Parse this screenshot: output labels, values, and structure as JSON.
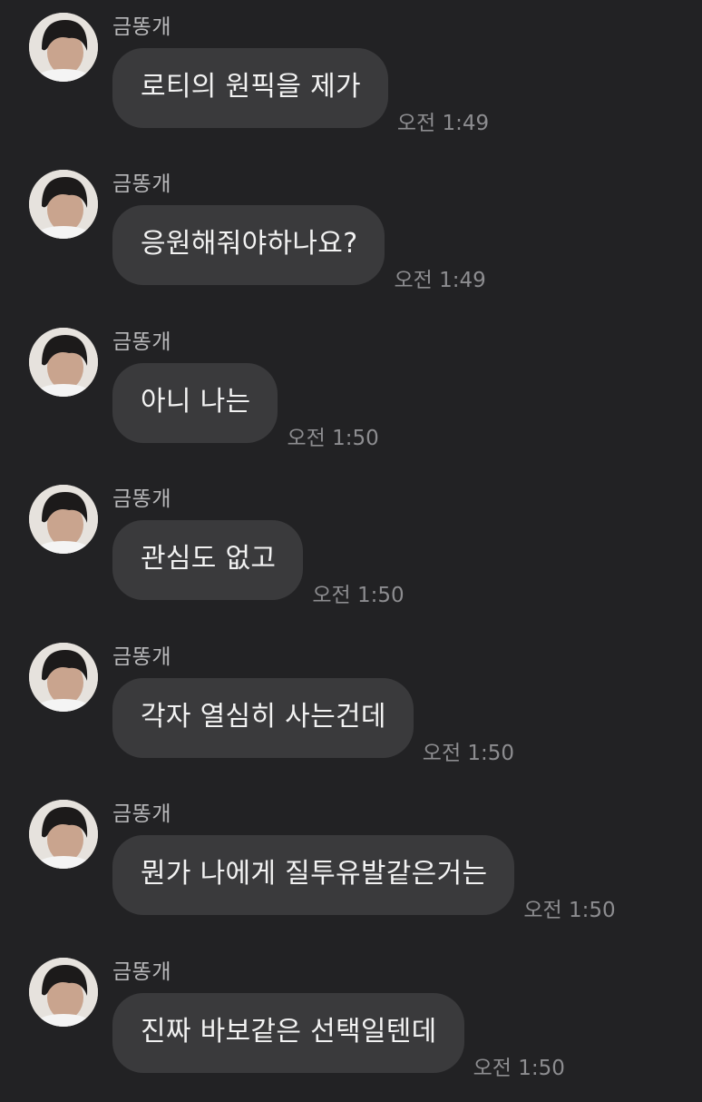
{
  "messages": [
    {
      "sender": "금똥개",
      "text": "로티의 원픽을 제가",
      "time": "오전 1:49"
    },
    {
      "sender": "금똥개",
      "text": "응원해줘야하나요?",
      "time": "오전 1:49"
    },
    {
      "sender": "금똥개",
      "text": "아니 나는",
      "time": "오전 1:50"
    },
    {
      "sender": "금똥개",
      "text": "관심도 없고",
      "time": "오전 1:50"
    },
    {
      "sender": "금똥개",
      "text": "각자 열심히 사는건데",
      "time": "오전 1:50"
    },
    {
      "sender": "금똥개",
      "text": "뭔가 나에게 질투유발같은거는",
      "time": "오전 1:50"
    },
    {
      "sender": "금똥개",
      "text": "진짜 바보같은 선택일텐데",
      "time": "오전 1:50"
    }
  ],
  "avatar_icon": "profile-photo"
}
